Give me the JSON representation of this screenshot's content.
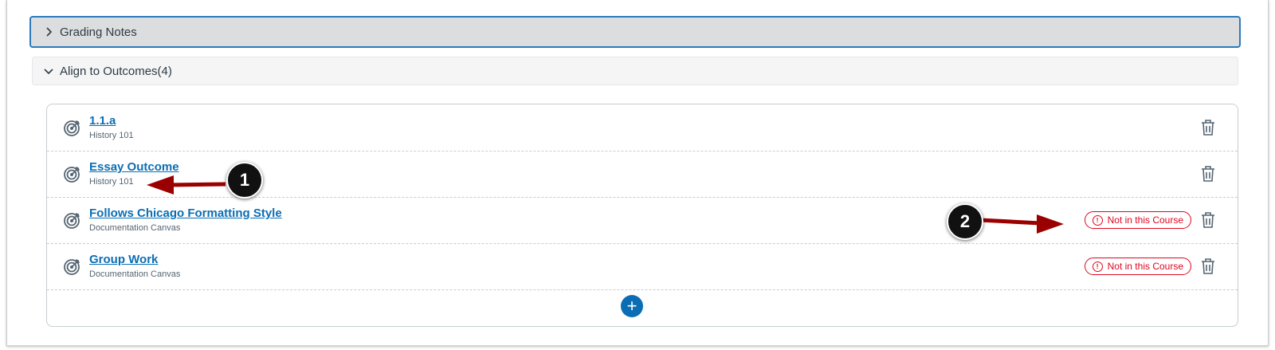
{
  "sections": {
    "grading_notes": "Grading Notes",
    "align_outcomes": "Align to Outcomes(4)"
  },
  "outcomes": [
    {
      "title": "1.1.a",
      "course": "History 101",
      "badge": ""
    },
    {
      "title": "Essay Outcome",
      "course": "History 101",
      "badge": ""
    },
    {
      "title": "Follows Chicago Formatting Style",
      "course": "Documentation Canvas",
      "badge": "Not in this Course"
    },
    {
      "title": "Group Work",
      "course": "Documentation Canvas",
      "badge": "Not in this Course"
    }
  ],
  "callouts": [
    "1",
    "2"
  ],
  "colors": {
    "link": "#0b6eb4",
    "warning": "#e0061f",
    "focus_border": "#2b7abc",
    "callout_arrow": "#9b0000"
  },
  "icons": {
    "outcome": "target-icon",
    "delete": "trash-icon",
    "warning": "exclamation-circle-icon",
    "add": "plus-icon",
    "collapsed": "chevron-right-icon",
    "expanded": "chevron-down-icon"
  }
}
